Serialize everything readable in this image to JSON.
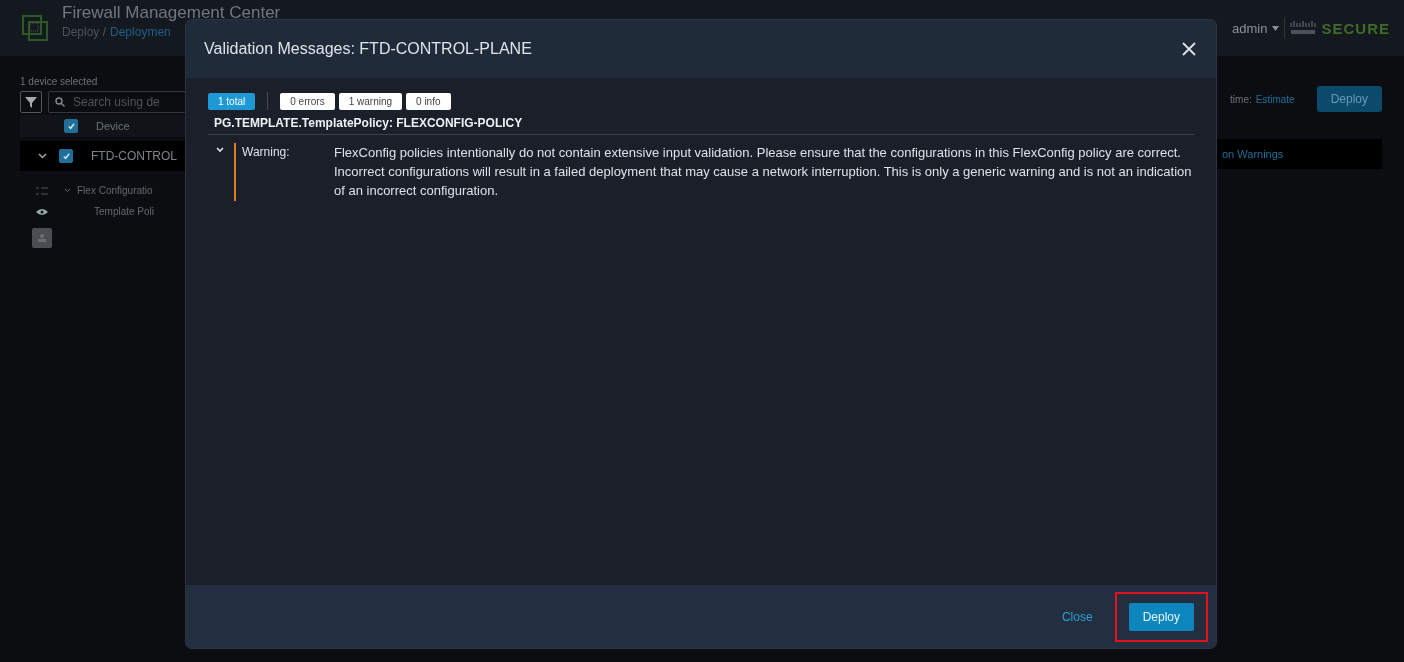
{
  "app": {
    "title": "Firewall Management Center",
    "breadcrumb": [
      {
        "label": "Deploy /",
        "link": false
      },
      {
        "label": "Deploymen",
        "link": true
      }
    ],
    "user": "admin",
    "brand": "SECURE"
  },
  "devices": {
    "selection_count": "1 device selected",
    "search": {
      "placeholder": "Search using de"
    },
    "header": {
      "label": "Device",
      "checked": true
    },
    "rows": [
      {
        "name": "FTD-CONTROL",
        "checked": true,
        "expanded": true,
        "status": "on Warnings"
      }
    ],
    "details": [
      {
        "label": "Flex Configuratio",
        "expanded": true
      },
      {
        "label": "Template Poli"
      }
    ],
    "estimate_label": "time:",
    "estimate_link": "Estimate",
    "deploy": "Deploy"
  },
  "dialog": {
    "title": "Validation Messages: FTD-CONTROL-PLANE",
    "filters": [
      {
        "label": "1 total",
        "selected": true
      },
      {
        "label": "0 errors",
        "selected": false
      },
      {
        "label": "1 warning",
        "selected": false
      },
      {
        "label": "0 info",
        "selected": false
      }
    ],
    "policy": "PG.TEMPLATE.TemplatePolicy: FLEXCONFIG-POLICY",
    "messages": [
      {
        "kind": "warning",
        "severity": "Warning:",
        "expanded": true,
        "text": "FlexConfig policies intentionally do not contain extensive input validation. Please ensure that the configurations in this FlexConfig policy are correct. Incorrect configurations will result in a failed deployment that may cause a network interruption. This is only a generic warning and is not an indication of an incorrect configuration."
      }
    ],
    "close": "Close",
    "deploy": {
      "label": "Deploy",
      "highlighted": true
    }
  }
}
